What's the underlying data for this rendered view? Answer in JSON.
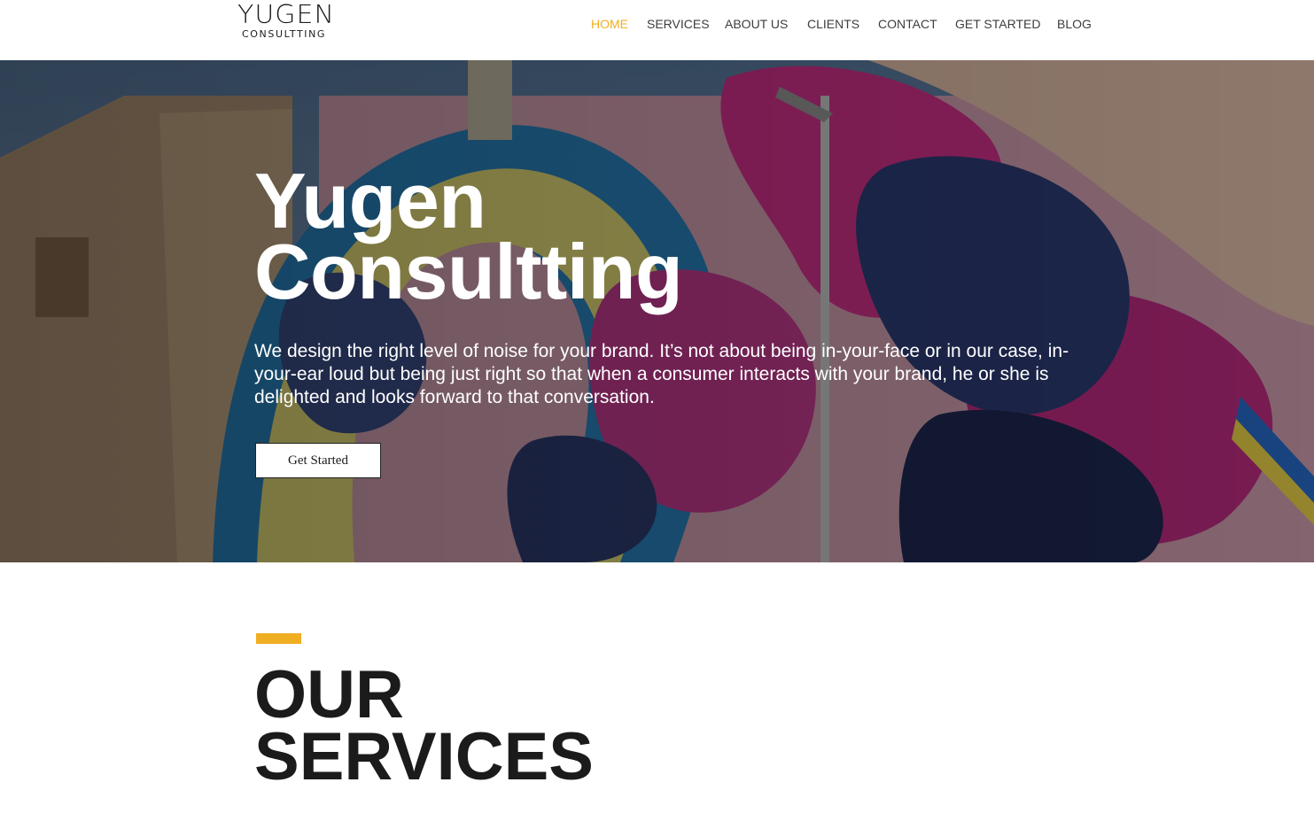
{
  "brand": {
    "logo_word": "YUGEN",
    "logo_sub": "CONSULTTING"
  },
  "nav": {
    "items": [
      {
        "label": "HOME",
        "active": true
      },
      {
        "label": "SERVICES",
        "active": false
      },
      {
        "label": "ABOUT US",
        "active": false
      },
      {
        "label": "CLIENTS",
        "active": false
      },
      {
        "label": "CONTACT",
        "active": false
      },
      {
        "label": "GET STARTED",
        "active": false
      },
      {
        "label": "BLOG",
        "active": false
      }
    ]
  },
  "hero": {
    "title_line1": "Yugen",
    "title_line2": "Consultting",
    "text": "We design the right level of noise for your brand. It’s not about being in-your-face or in our case, in-your-ear loud but being just right so that when a consumer interacts with your brand, he or she is delighted and looks forward to that conversation.",
    "button_label": "Get Started"
  },
  "services": {
    "title_line1": "OUR",
    "title_line2": "SERVICES"
  },
  "colors": {
    "accent": "#f0ae22",
    "text": "#1b1b1b",
    "nav_text": "#3d3d3d"
  }
}
